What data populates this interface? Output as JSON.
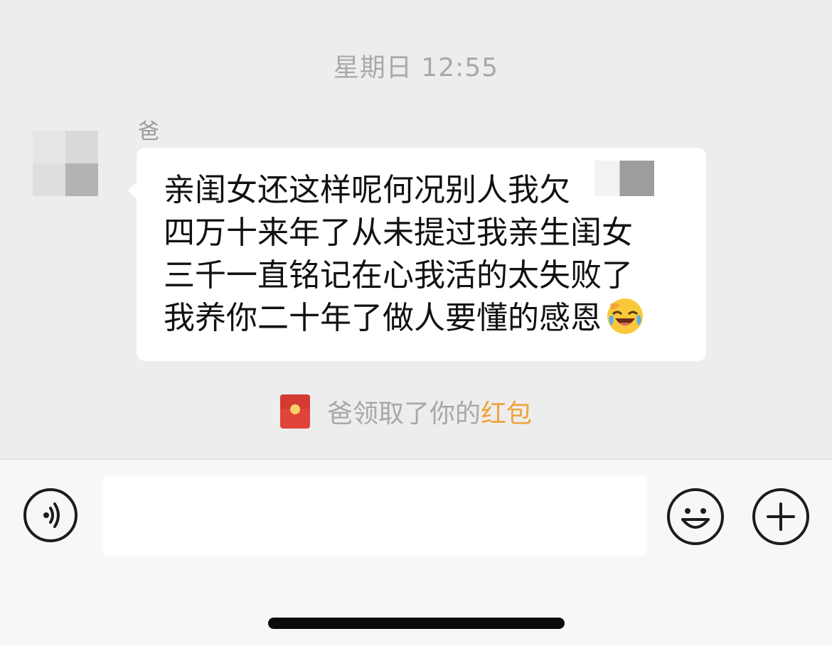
{
  "chat": {
    "timestamp": "星期日 12:55",
    "sender_name": "爸",
    "message_lines": [
      "亲闺女还这样呢何况别人我欠",
      "四万十来年了从未提过我亲生闺女",
      "三千一直铭记在心我活的太失败了",
      "我养你二十年了做人要懂的感恩"
    ],
    "message_emoji": "laughing-crying-face-icon",
    "system_notice": {
      "prefix": "爸领取了你的",
      "highlight": "红包",
      "icon": "red-packet-icon"
    }
  },
  "input_bar": {
    "text_value": "",
    "icons": {
      "voice": "voice-input-icon",
      "emoji": "emoji-smile-icon",
      "more": "plus-icon"
    }
  },
  "colors": {
    "chat_background": "#ededed",
    "bubble_background": "#ffffff",
    "timestamp_text": "#a9a9a9",
    "system_highlight": "#f0a23b",
    "red_packet": "#e0443a"
  }
}
